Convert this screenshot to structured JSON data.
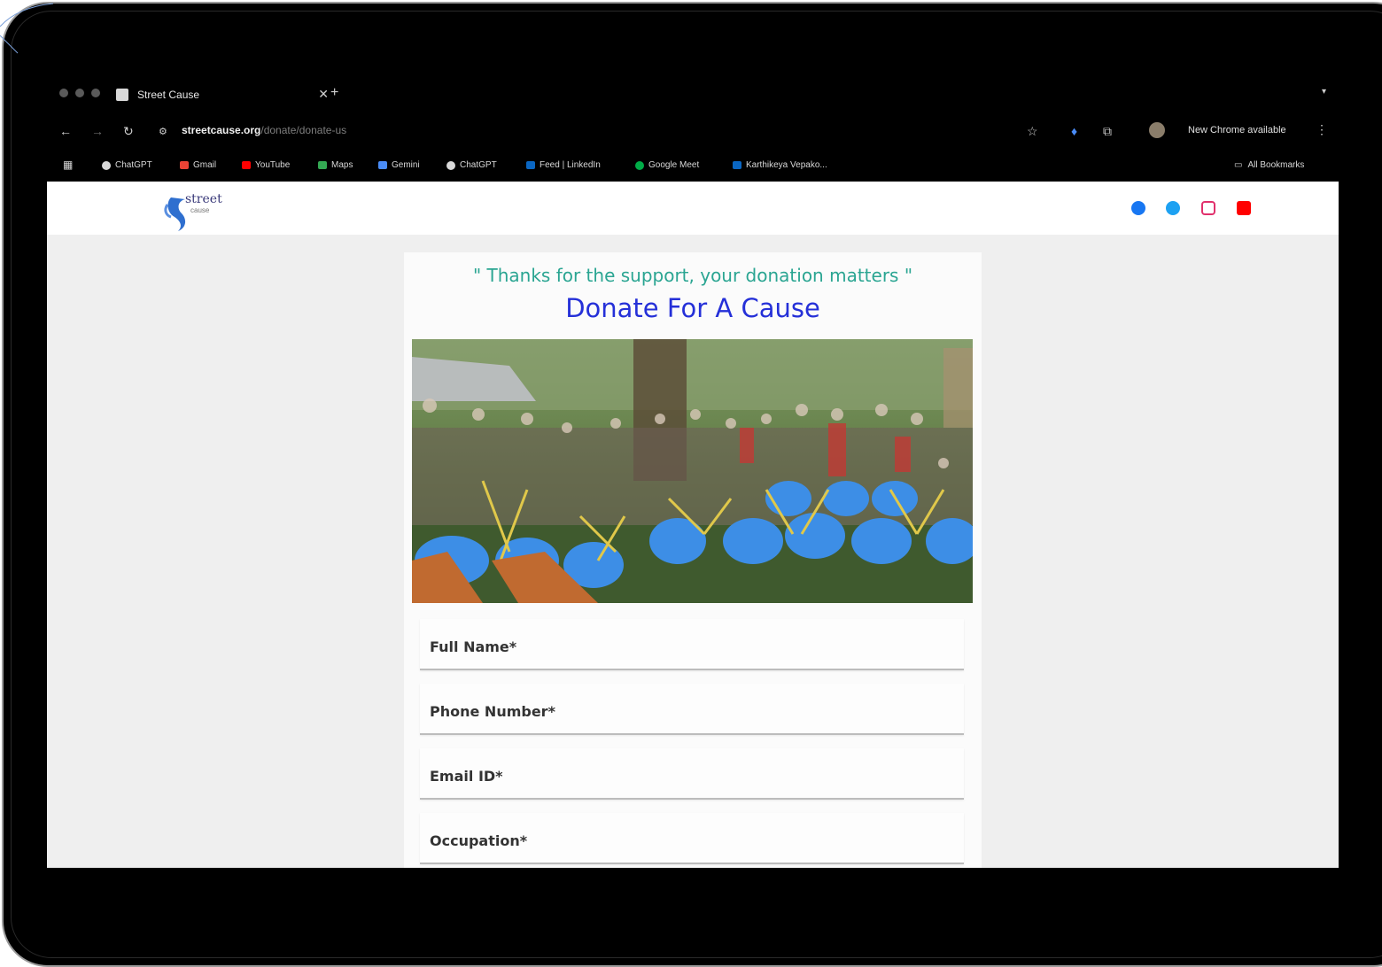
{
  "browser": {
    "tab_title": "Street Cause",
    "url_domain": "streetcause.org",
    "url_path": "/donate/donate-us",
    "new_chrome_label": "New Chrome available",
    "bookmarks": [
      {
        "label": "ChatGPT",
        "icon": "chatgpt-icon",
        "color": "#d9d9d9"
      },
      {
        "label": "Gmail",
        "icon": "gmail-icon",
        "color": "#ea4335"
      },
      {
        "label": "YouTube",
        "icon": "youtube-icon",
        "color": "#ff0000"
      },
      {
        "label": "Maps",
        "icon": "maps-icon",
        "color": "#34a853"
      },
      {
        "label": "Gemini",
        "icon": "gemini-icon",
        "color": "#4a8cf7"
      },
      {
        "label": "ChatGPT",
        "icon": "chatgpt-icon",
        "color": "#d9d9d9"
      },
      {
        "label": "Feed | LinkedIn",
        "icon": "linkedin-icon",
        "color": "#0a66c2"
      },
      {
        "label": "Google Meet",
        "icon": "meet-icon",
        "color": "#00ac47"
      },
      {
        "label": "Karthikeya Vepako...",
        "icon": "linkedin-icon",
        "color": "#0a66c2"
      }
    ],
    "all_bookmarks_label": "All Bookmarks"
  },
  "site": {
    "logo_text": "street",
    "logo_sub": "cause",
    "social": [
      {
        "name": "facebook-icon",
        "color": "#1877f2"
      },
      {
        "name": "twitter-icon",
        "color": "#1da1f2"
      },
      {
        "name": "instagram-icon",
        "color": "#e1306c"
      },
      {
        "name": "youtube-icon",
        "color": "#ff0000"
      }
    ]
  },
  "donation": {
    "thanks_text": "\" Thanks for the support, your donation matters \"",
    "title": "Donate For A Cause",
    "fields": [
      {
        "label": "Full Name*"
      },
      {
        "label": "Phone Number*"
      },
      {
        "label": "Email ID*"
      },
      {
        "label": "Occupation*"
      }
    ]
  },
  "colors": {
    "thanks": "#2aa592",
    "title": "#2530d8",
    "page_bg": "#efefef"
  }
}
